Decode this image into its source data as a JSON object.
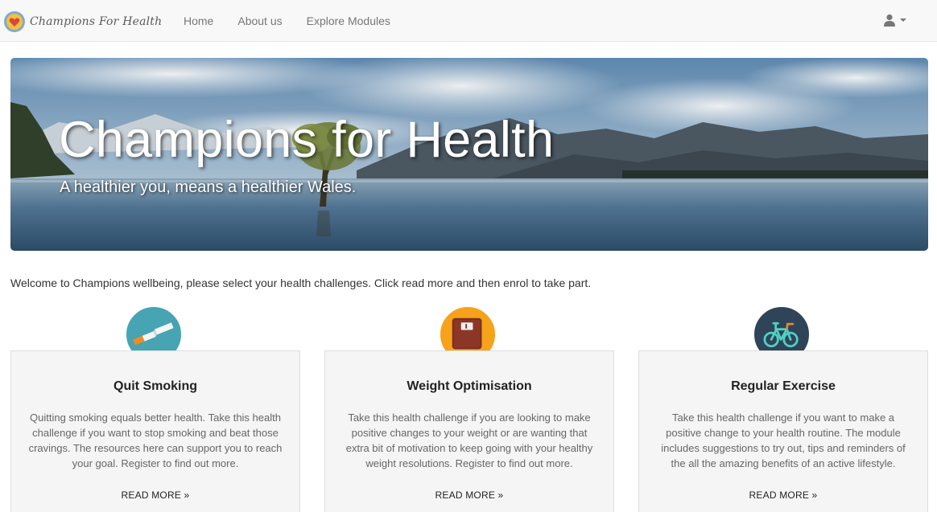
{
  "brand": {
    "name": "Champions For Health"
  },
  "nav": {
    "items": [
      {
        "label": "Home"
      },
      {
        "label": "About us"
      },
      {
        "label": "Explore Modules"
      }
    ],
    "user_icon": "user-icon"
  },
  "hero": {
    "title": "Champions for Health",
    "subtitle": "A healthier you, means a healthier Wales."
  },
  "intro": "Welcome to Champions wellbeing, please select your health challenges. Click read more and then enrol to take part.",
  "cards": [
    {
      "title": "Quit Smoking",
      "text": "Quitting smoking equals better health. Take this health challenge if you want to stop smoking and beat those cravings. The resources here can support you to reach your goal. Register to find out more.",
      "link": "READ MORE »",
      "icon": "cigarette-icon",
      "icon_bg": "#46a4b3"
    },
    {
      "title": "Weight Optimisation",
      "text": "Take this health challenge if you are looking to make positive changes to your weight or are wanting that extra bit of motivation to keep going with your healthy weight resolutions. Register to find out more.",
      "link": "READ MORE »",
      "icon": "scale-icon",
      "icon_bg": "#f7a21b"
    },
    {
      "title": "Regular Exercise",
      "text": "Take this health challenge if you want to make a positive change to your health routine. The module includes suggestions to try out, tips and reminders of the all the amazing benefits of an active lifestyle.",
      "link": "READ MORE »",
      "icon": "bicycle-icon",
      "icon_bg": "#2f4458"
    }
  ]
}
